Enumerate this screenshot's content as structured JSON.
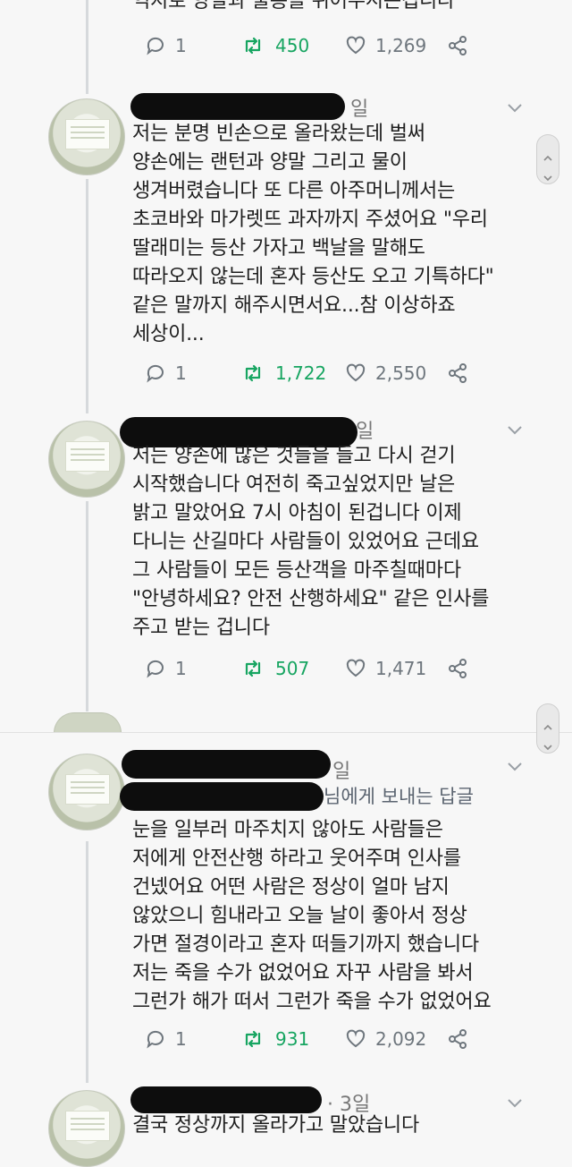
{
  "thread": {
    "top_partial_text": "억지로 양말과 물통을 쥐어주시는겁니다",
    "top_actions": {
      "replies": "1",
      "retweets": "450",
      "likes": "1,269"
    },
    "tweets": [
      {
        "time": "일",
        "reply_to": "",
        "text": "저는 분명 빈손으로 올라왔는데 벌써\n양손에는 랜턴과 양말 그리고 물이\n생겨버렸습니다 또 다른 아주머니께서는\n초코바와 마가렛뜨 과자까지 주셨어요 \"우리\n딸래미는 등산 가자고 백날을 말해도\n따라오지 않는데 혼자 등산도 오고 기특하다\"\n같은 말까지 해주시면서요...참 이상하죠\n세상이...",
        "replies": "1",
        "retweets": "1,722",
        "likes": "2,550"
      },
      {
        "time": "일",
        "reply_to": "",
        "text": "저는 양손에 많은 것들을 들고 다시 걷기\n시작했습니다 여전히 죽고싶었지만 날은\n밝고 말았어요 7시 아침이 된겁니다 이제\n다니는 산길마다 사람들이 있었어요 근데요\n그 사람들이 모든 등산객을 마주칠때마다\n\"안녕하세요? 안전 산행하세요\" 같은 인사를\n주고 받는 겁니다",
        "replies": "1",
        "retweets": "507",
        "likes": "1,471"
      },
      {
        "time": "일",
        "reply_to": "님에게 보내는 답글",
        "text": "눈을 일부러 마주치지 않아도 사람들은\n저에게 안전산행 하라고 웃어주며 인사를\n건넸어요 어떤 사람은 정상이 얼마 남지\n않았으니 힘내라고 오늘 날이 좋아서 정상\n가면 절경이라고 혼자 떠들기까지 했습니다\n저는 죽을 수가 없었어요 자꾸 사람을 봐서\n그런가 해가 떠서 그런가 죽을 수가 없었어요",
        "replies": "1",
        "retweets": "931",
        "likes": "2,092"
      },
      {
        "time": "· 3일",
        "reply_to": "",
        "text": "결국 정상까지 올라가고 말았습니다",
        "replies": "",
        "retweets": "",
        "likes": ""
      }
    ]
  },
  "icons": {
    "reply": "reply-icon",
    "retweet": "retweet-icon",
    "like": "heart-icon",
    "share": "share-icon",
    "more": "chevron-down-icon"
  },
  "colors": {
    "background": "#f7f7f7",
    "retweet_green": "#17a561",
    "meta_gray": "#6e767d",
    "redaction": "#0d0d0d"
  }
}
